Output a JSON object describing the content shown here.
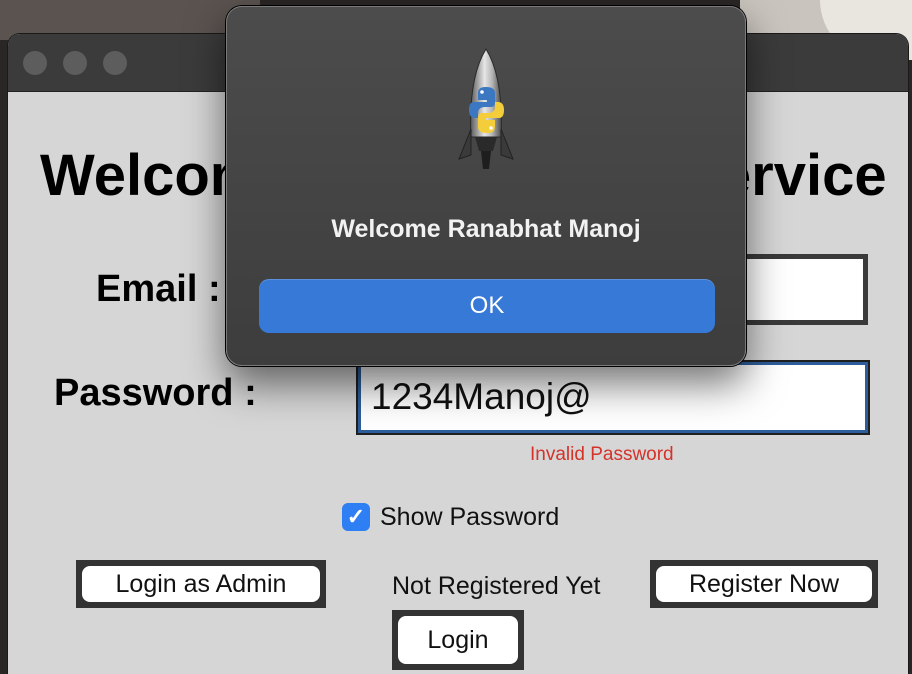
{
  "app": {
    "title": "Welcome to the Online Service",
    "email_label": "Email :",
    "password_label": "Password :",
    "email_value": "",
    "password_value": "1234Manoj@",
    "error_text": "Invalid Password",
    "show_password_label": "Show Password",
    "show_password_checked": true,
    "login_admin_label": "Login as Admin",
    "not_registered_text": "Not Registered Yet",
    "register_label": "Register Now",
    "login_label": "Login"
  },
  "dialog": {
    "icon": "python-launcher-rocket-icon",
    "message": "Welcome Ranabhat Manoj",
    "ok_label": "OK"
  },
  "colors": {
    "accent": "#3779d6",
    "error": "#d5322a",
    "checkbox": "#2f7ff4"
  }
}
